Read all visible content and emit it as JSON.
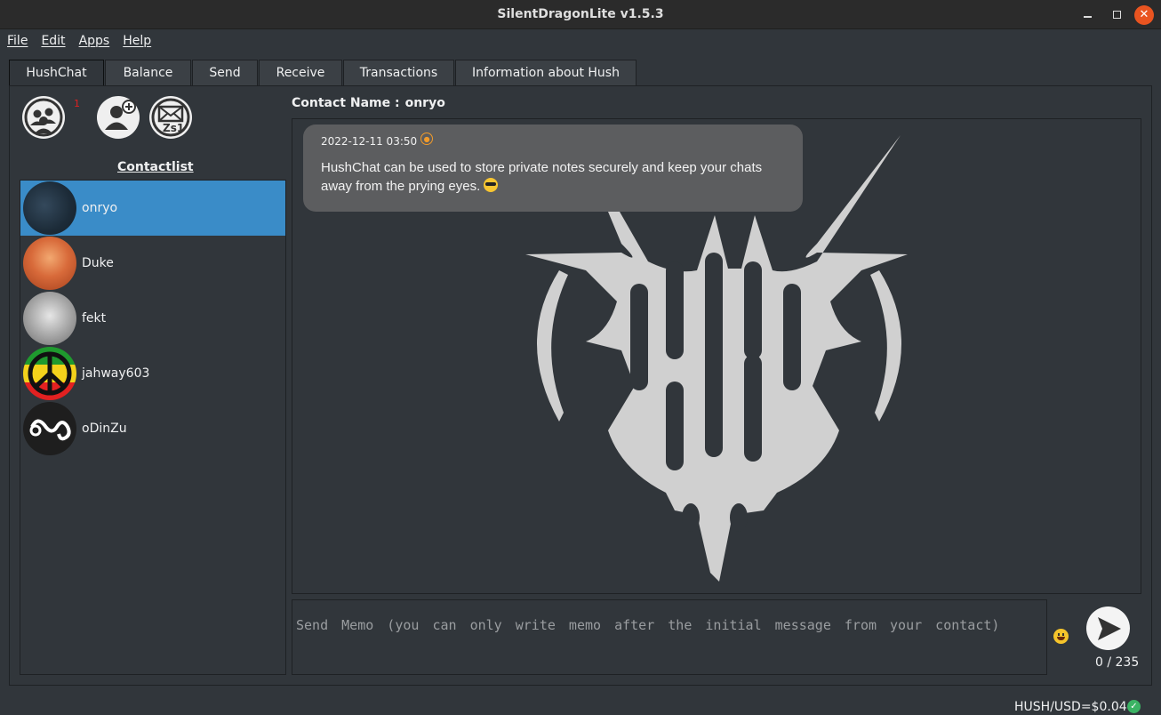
{
  "window": {
    "title": "SilentDragonLite v1.5.3"
  },
  "menu": [
    "File",
    "Edit",
    "Apps",
    "Help"
  ],
  "tabs": [
    "HushChat",
    "Balance",
    "Send",
    "Receive",
    "Transactions",
    "Information about Hush"
  ],
  "toolbar": {
    "requests_badge": "1"
  },
  "contactlist": {
    "title": "Contactlist",
    "contacts": [
      {
        "name": "onryo",
        "selected": true
      },
      {
        "name": "Duke"
      },
      {
        "name": "fekt"
      },
      {
        "name": "jahway603"
      },
      {
        "name": "oDinZu"
      }
    ]
  },
  "chat": {
    "contact_label": "Contact Name :",
    "contact_name": "onryo",
    "messages": [
      {
        "timestamp": "2022-12-11 03:50",
        "text": "HushChat can be used to store private notes securely and keep your chats away from the prying eyes."
      }
    ]
  },
  "memo": {
    "placeholder": "Send Memo (you can only write memo after the initial message from your contact)",
    "counter": "0 / 235"
  },
  "status": {
    "price": "HUSH/USD=$0.04"
  },
  "colors": {
    "accent": "#3a8cc8",
    "background": "#31363b",
    "bubble": "#5c5d5f",
    "status_ok": "#3bb364"
  }
}
